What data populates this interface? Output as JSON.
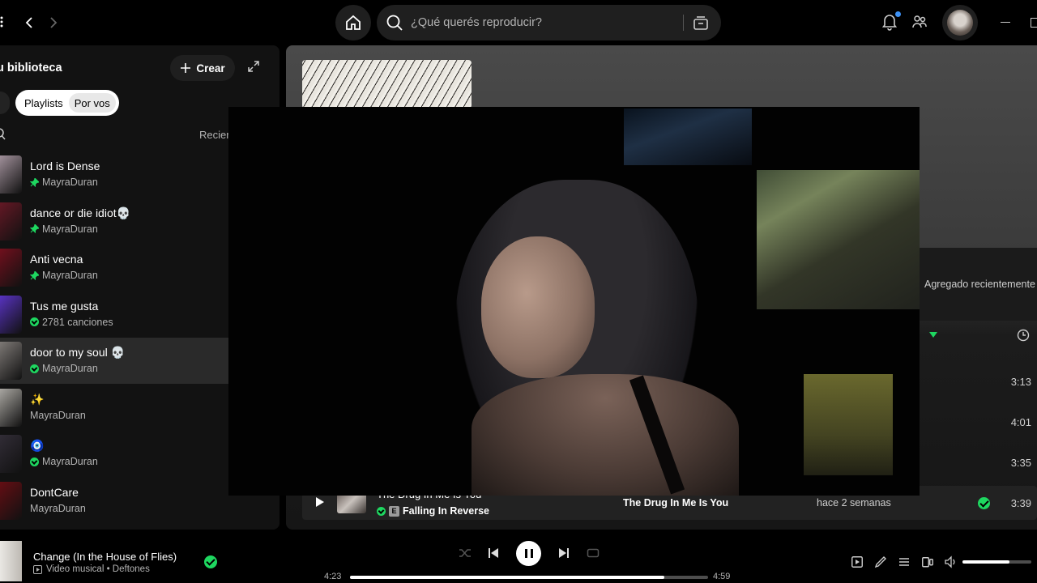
{
  "topbar": {
    "search_placeholder": "¿Qué querés reproducir?",
    "icons": [
      "back-icon",
      "forward-icon",
      "home-icon",
      "search-icon",
      "browse-icon",
      "bell-icon",
      "friends-icon",
      "avatar"
    ]
  },
  "sidebar": {
    "title": "u biblioteca",
    "create_label": "Crear",
    "chips": [
      "Playlists",
      "Por vos"
    ],
    "sort_label": "Recien",
    "items": [
      {
        "name": "Lord is Dense",
        "sub": "MayraDuran",
        "marker": "pin",
        "cover": "#c7b2bf"
      },
      {
        "name": "dance or die idiot💀",
        "sub": "MayraDuran",
        "marker": "pin",
        "cover": "#7a1a2a"
      },
      {
        "name": "Anti vecna",
        "sub": "MayraDuran",
        "marker": "pin",
        "cover": "#8a1020"
      },
      {
        "name": "Tus me gusta",
        "sub": "2781 canciones",
        "marker": "download",
        "cover": "#6b3cf0"
      },
      {
        "name": "door to my soul 💀",
        "sub": "MayraDuran",
        "marker": "download",
        "cover": "#9a9490",
        "selected": true
      },
      {
        "name": "✨",
        "sub": "MayraDuran",
        "marker": "none",
        "cover": "#d2cec8"
      },
      {
        "name": "🧿",
        "sub": "MayraDuran",
        "marker": "download",
        "cover": "#3a3440"
      },
      {
        "name": "DontCare",
        "sub": "MayraDuran",
        "marker": "none",
        "cover": "#7a0d14"
      }
    ]
  },
  "main": {
    "column_added": "Agregado recientemente",
    "durations": [
      "3:13",
      "4:01",
      "3:35"
    ],
    "track": {
      "title": "The Drug In Me Is You",
      "explicit": "E",
      "artist": "Falling In Reverse",
      "album": "The Drug In Me Is You",
      "added": "hace 2 semanas",
      "duration": "3:39"
    }
  },
  "player": {
    "title": "Change (In the House of Flies)",
    "sub": "Video musical • Deftones",
    "elapsed": "4:23",
    "total": "4:59",
    "progress": 0.878,
    "volume": 0.68
  },
  "colors": {
    "accent": "#1ed760",
    "background": "#121212",
    "notification": "#3d91f4"
  }
}
